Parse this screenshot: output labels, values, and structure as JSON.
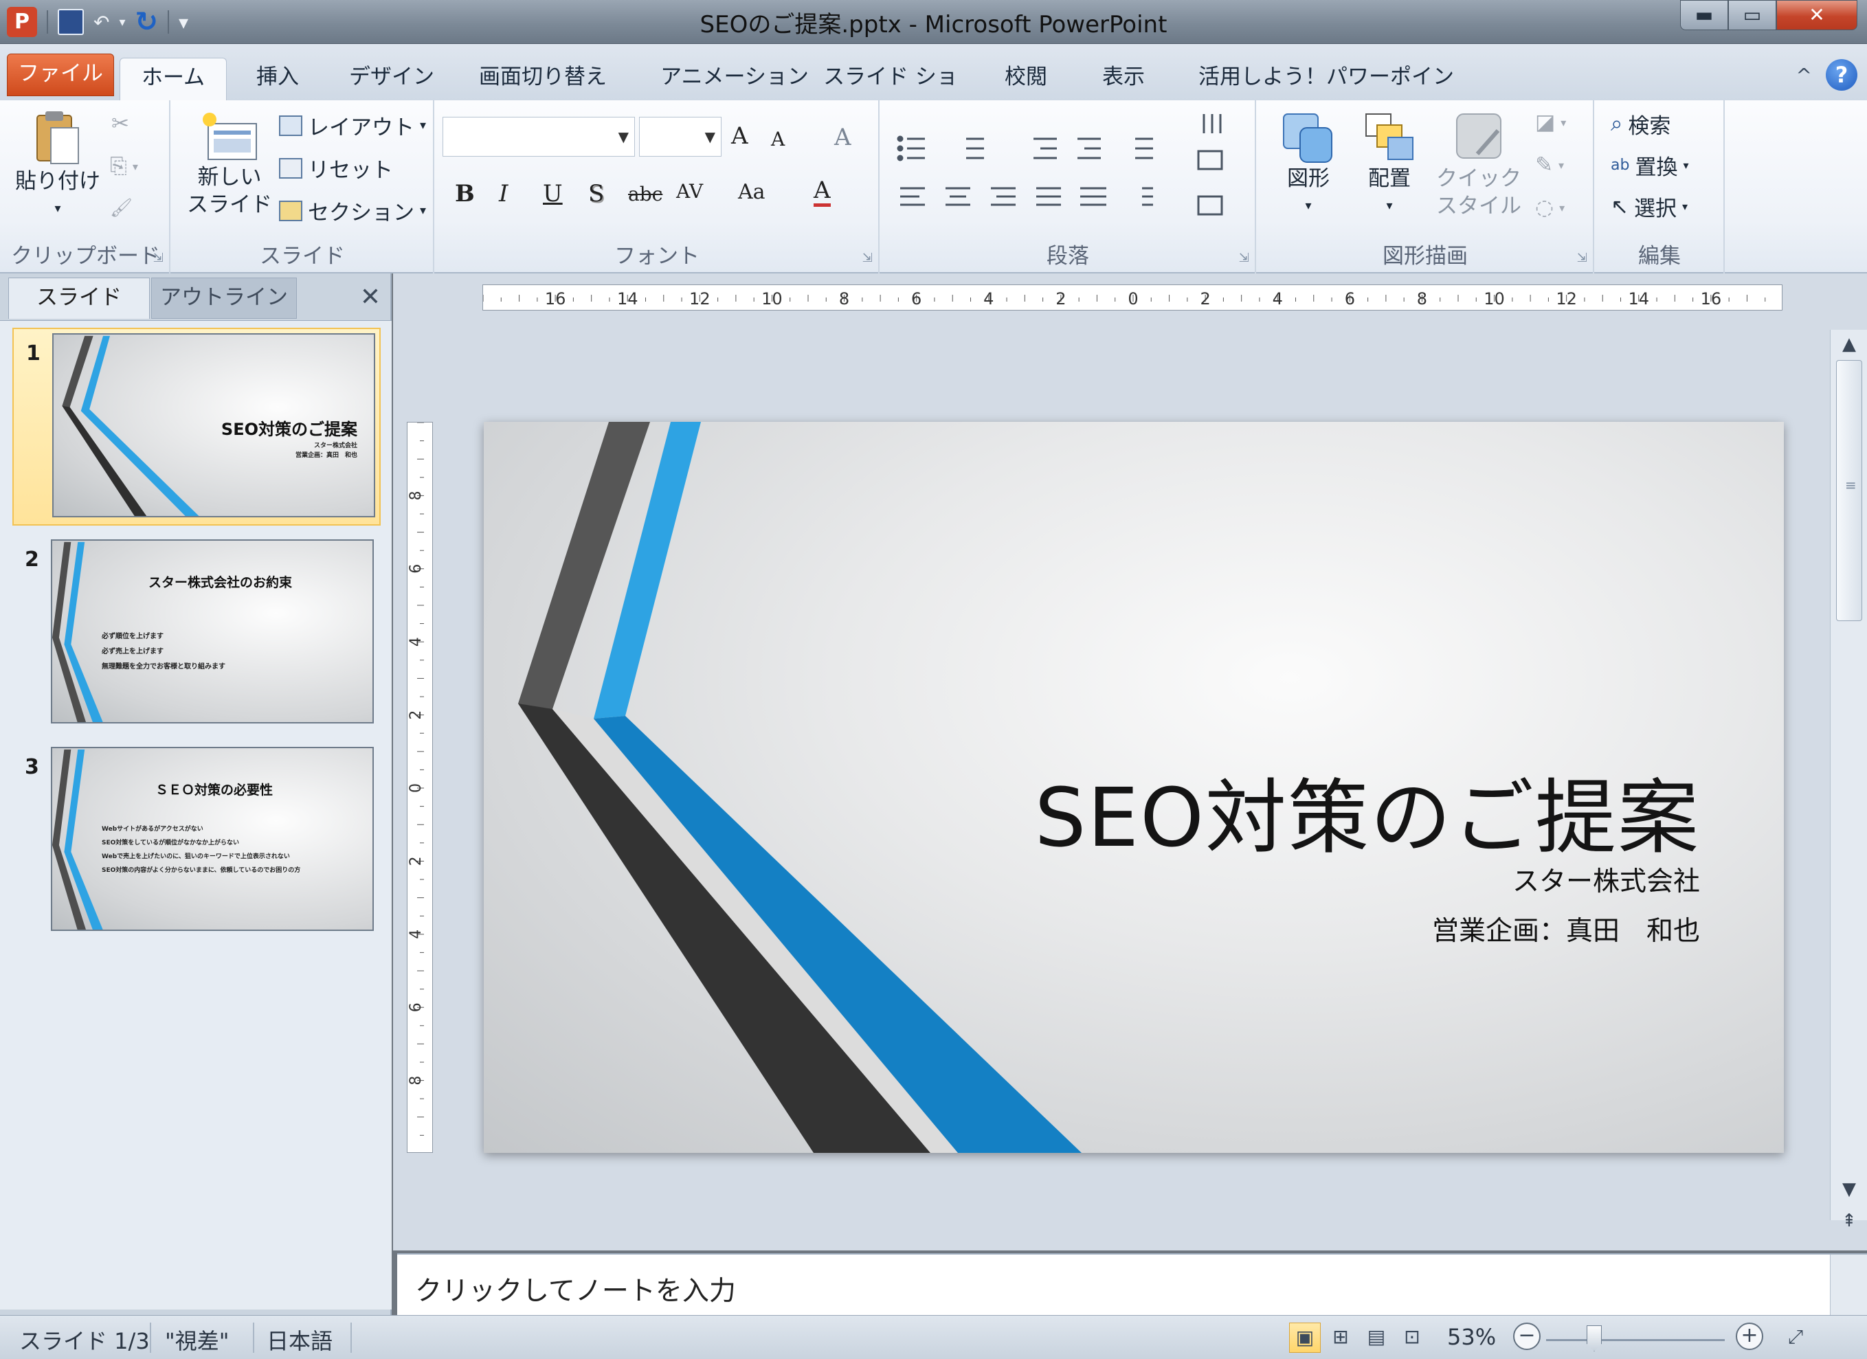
{
  "window": {
    "title": "SEOのご提案.pptx - Microsoft PowerPoint",
    "app_icon": "P",
    "minimize": "▬",
    "maximize": "▭",
    "close": "✕"
  },
  "qat": {
    "save_icon": "save-icon",
    "undo": "↶",
    "redo": "↻",
    "customize": "▾"
  },
  "ribbon_tabs": {
    "file": "ファイル",
    "items": [
      "ホーム",
      "挿入",
      "デザイン",
      "画面切り替え",
      "アニメーション",
      "スライド ショー",
      "校閲",
      "表示",
      "活用しよう！パワーポイント"
    ],
    "active": "ホーム",
    "minimize_caret": "^",
    "help": "?"
  },
  "clipboard": {
    "paste": "貼り付け",
    "label": "クリップボード",
    "cut": "✂",
    "copy": "⎘",
    "format_painter": "🖌"
  },
  "slides_group": {
    "new_slide_1": "新しい",
    "new_slide_2": "スライド",
    "layout": "レイアウト",
    "reset": "リセット",
    "section": "セクション",
    "label": "スライド"
  },
  "font": {
    "label": "フォント",
    "font_name": "",
    "font_size": "",
    "grow": "A",
    "shrink": "A",
    "clear": "A",
    "bold": "B",
    "italic": "I",
    "underline": "U",
    "shadow": "S",
    "strike": "abc",
    "spacing": "AV",
    "case": "Aa",
    "color": "A"
  },
  "paragraph": {
    "label": "段落"
  },
  "drawing": {
    "shapes": "図形",
    "arrange": "配置",
    "quick_style_1": "クイック",
    "quick_style_2": "スタイル",
    "label": "図形描画"
  },
  "editing": {
    "find": "検索",
    "replace": "置換",
    "select": "選択",
    "label": "編集"
  },
  "left_pane": {
    "tab_slides": "スライド",
    "tab_outline": "アウトライン",
    "close": "✕",
    "thumbnails": [
      {
        "num": "1",
        "title": "SEO対策のご提案",
        "lines": [
          "スター株式会社",
          "営業企画：真田　和也"
        ]
      },
      {
        "num": "2",
        "title": "スター株式会社のお約束",
        "lines": [
          "必ず順位を上げます",
          "必ず売上を上げます",
          "無理難題を全力でお客様と取り組みます"
        ]
      },
      {
        "num": "3",
        "title": "ＳＥＯ対策の必要性",
        "lines": [
          "Webサイトがあるがアクセスがない",
          "SEO対策をしているが順位がなかなか上がらない",
          "Webで売上を上げたいのに、狙いのキーワードで上位表示されない",
          "SEO対策の内容がよく分からないままに、依頼しているのでお困りの方"
        ]
      }
    ]
  },
  "ruler": {
    "h_labels": [
      "16",
      "14",
      "12",
      "10",
      "8",
      "6",
      "4",
      "2",
      "0",
      "2",
      "4",
      "6",
      "8",
      "10",
      "12",
      "14",
      "16"
    ],
    "v_labels": [
      "8",
      "6",
      "4",
      "2",
      "0",
      "2",
      "4",
      "6",
      "8"
    ]
  },
  "slide": {
    "title": "SEO対策のご提案",
    "subtitle_company": "スター株式会社",
    "subtitle_person": "営業企画：真田　和也",
    "accent_blue": "#2EA3E3",
    "accent_dark_blue": "#1480C4",
    "band_dark": "#3a3a3a",
    "band_mid": "#565656"
  },
  "notes": {
    "placeholder": "クリックしてノートを入力"
  },
  "status": {
    "slide_counter": "スライド 1/3",
    "theme": "\"視差\"",
    "language": "日本語",
    "zoom": "53%",
    "zoom_fraction": 0.53,
    "minus": "−",
    "plus": "+",
    "fit": "⤢"
  }
}
